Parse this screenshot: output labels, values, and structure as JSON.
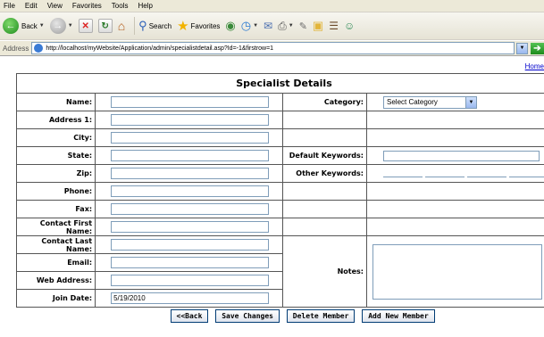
{
  "menu": [
    "File",
    "Edit",
    "View",
    "Favorites",
    "Tools",
    "Help"
  ],
  "toolbar": {
    "back_label": "Back",
    "search_label": "Search",
    "favorites_label": "Favorites"
  },
  "address": {
    "label": "Address",
    "url": "http://localhost/myWebsite/Application/admin/specialistdetail.asp?Id=-1&firstrow=1"
  },
  "page": {
    "home_link": "Home",
    "title": "Specialist Details",
    "fields": {
      "name": "Name:",
      "address1": "Address 1:",
      "city": "City:",
      "state": "State:",
      "zip": "Zip:",
      "phone": "Phone:",
      "fax": "Fax:",
      "contact_first": "Contact First Name:",
      "contact_last": "Contact Last Name:",
      "email": "Email:",
      "web_address": "Web Address:",
      "join_date": "Join Date:",
      "category": "Category:",
      "default_keywords": "Default Keywords:",
      "other_keywords": "Other Keywords:",
      "notes": "Notes:"
    },
    "values": {
      "join_date": "5/19/2010",
      "category_selected": "Select Category"
    },
    "buttons": {
      "back": "<<Back",
      "save": "Save Changes",
      "delete": "Delete Member",
      "add": "Add New Member"
    }
  }
}
